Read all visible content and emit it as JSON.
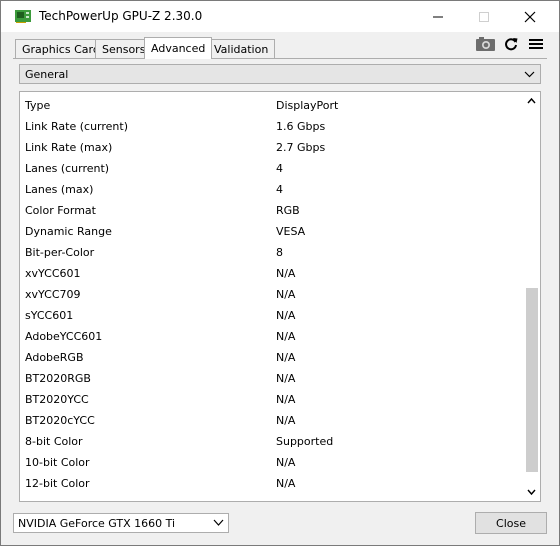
{
  "window": {
    "title": "TechPowerUp GPU-Z 2.30.0"
  },
  "tabs": [
    {
      "label": "Graphics Card"
    },
    {
      "label": "Sensors"
    },
    {
      "label": "Advanced"
    },
    {
      "label": "Validation"
    }
  ],
  "active_tab": "Advanced",
  "category_select": {
    "value": "General"
  },
  "properties": [
    {
      "key": "Type",
      "value": "DisplayPort"
    },
    {
      "key": "Link Rate (current)",
      "value": "1.6 Gbps"
    },
    {
      "key": "Link Rate (max)",
      "value": "2.7 Gbps"
    },
    {
      "key": "Lanes (current)",
      "value": "4"
    },
    {
      "key": "Lanes (max)",
      "value": "4"
    },
    {
      "key": "Color Format",
      "value": "RGB"
    },
    {
      "key": "Dynamic Range",
      "value": "VESA"
    },
    {
      "key": "Bit-per-Color",
      "value": "8"
    },
    {
      "key": "xvYCC601",
      "value": "N/A"
    },
    {
      "key": "xvYCC709",
      "value": "N/A"
    },
    {
      "key": "sYCC601",
      "value": "N/A"
    },
    {
      "key": "AdobeYCC601",
      "value": "N/A"
    },
    {
      "key": "AdobeRGB",
      "value": "N/A"
    },
    {
      "key": "BT2020RGB",
      "value": "N/A"
    },
    {
      "key": "BT2020YCC",
      "value": "N/A"
    },
    {
      "key": "BT2020cYCC",
      "value": "N/A"
    },
    {
      "key": "8-bit Color",
      "value": "Supported"
    },
    {
      "key": "10-bit Color",
      "value": "N/A"
    },
    {
      "key": "12-bit Color",
      "value": "N/A"
    }
  ],
  "gpu_select": {
    "value": "NVIDIA GeForce GTX 1660 Ti"
  },
  "close_button": {
    "label": "Close"
  },
  "icons": {
    "app": "gpuz-app-icon",
    "camera": "camera-icon",
    "refresh": "refresh-icon",
    "menu": "hamburger-menu-icon"
  },
  "colors": {
    "app_icon": "#3c9b3c",
    "scroll_thumb": "#cdcdcd",
    "border": "#adadad"
  }
}
